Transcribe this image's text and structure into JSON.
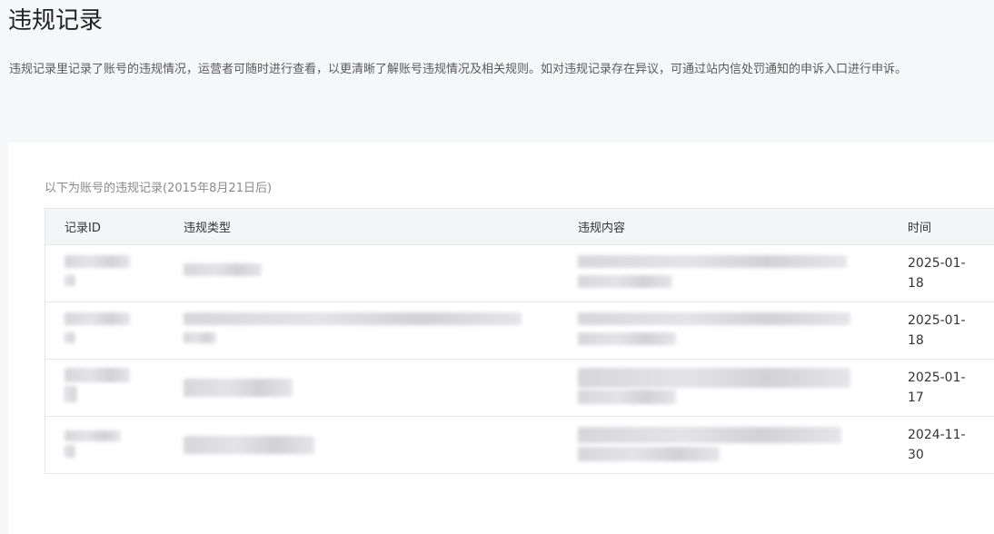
{
  "page": {
    "title": "违规记录",
    "description": "违规记录里记录了账号的违规情况，运营者可随时进行查看，以更清晰了解账号违规情况及相关规则。如对违规记录存在异议，可通过站内信处罚通知的申诉入口进行申诉。"
  },
  "records": {
    "caption": "以下为账号的违规记录(2015年8月21日后)",
    "columns": {
      "id": "记录ID",
      "type": "违规类型",
      "content": "违规内容",
      "time": "时间"
    },
    "rows": [
      {
        "time": "2025-01-18"
      },
      {
        "time": "2025-01-18"
      },
      {
        "time": "2025-01-17"
      },
      {
        "time": "2024-11-30"
      }
    ]
  }
}
